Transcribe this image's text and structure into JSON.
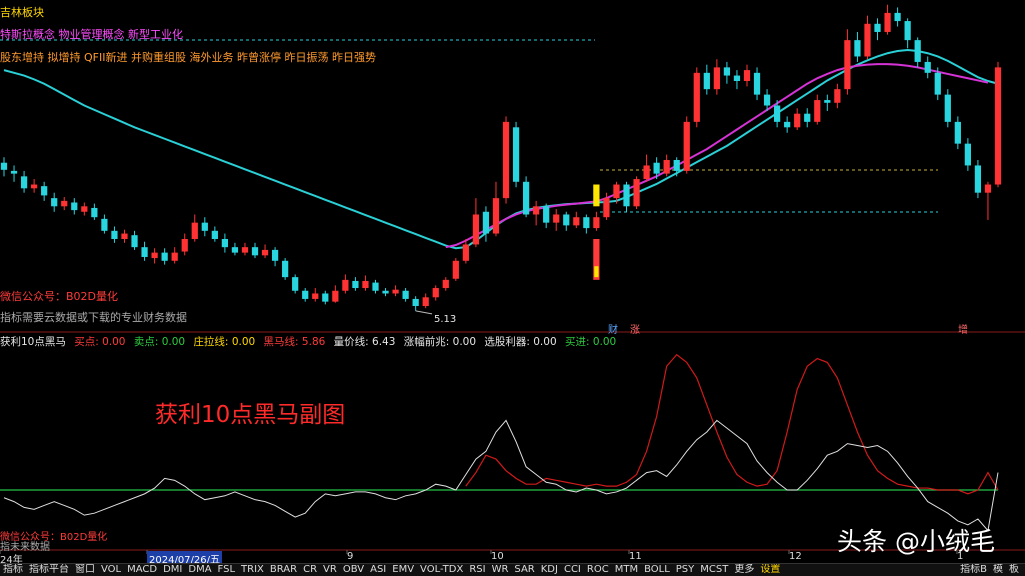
{
  "main_panel": {
    "sector_label": "吉林板块",
    "concept_line": "特斯拉概念 物业管理概念 新型工业化",
    "tags_line": "股东增持 拟增持 QFII新进 并购重组股 海外业务 昨曾涨停 昨日振荡 昨日强势",
    "wechat_note": "微信公众号：B02D量化",
    "data_note": "指标需要云数据或下载的专业财务数据",
    "low_price_label": "5.13",
    "event_markers": [
      "财",
      "涨",
      "增"
    ]
  },
  "indicator_header": {
    "title": "获利10点黑马",
    "items": [
      {
        "label": "买点: 0.00",
        "color": "#ff3b3b"
      },
      {
        "label": "卖点: 0.00",
        "color": "#2ecc40"
      },
      {
        "label": "庄拉线: 0.00",
        "color": "#ffd800"
      },
      {
        "label": "黑马线: 5.86",
        "color": "#ff3b3b"
      },
      {
        "label": "量价线: 6.43",
        "color": "#e6e6e6"
      },
      {
        "label": "涨幅前兆: 0.00",
        "color": "#e6e6e6"
      },
      {
        "label": "选股利器: 0.00",
        "color": "#e6e6e6"
      },
      {
        "label": "买进: 0.00",
        "color": "#2ecc40"
      }
    ]
  },
  "subchart_title": "获利10点黑马副图",
  "sub_notes": {
    "wechat_note": "微信公众号：B02D量化",
    "future_note": "指未来数据"
  },
  "watermark": "头条 @小绒毛",
  "date_axis": {
    "labels": [
      "24年",
      "2024/07/26/五",
      "9",
      "10",
      "11",
      "12",
      "1"
    ]
  },
  "tabbar": {
    "items": [
      "指标",
      "指标平台",
      "窗口",
      "VOL",
      "MACD",
      "DMI",
      "DMA",
      "FSL",
      "TRIX",
      "BRAR",
      "CR",
      "VR",
      "OBV",
      "ASI",
      "EMV",
      "VOL-TDX",
      "RSI",
      "WR",
      "SAR",
      "KDJ",
      "CCI",
      "ROC",
      "MTM",
      "BOLL",
      "PSY",
      "MCST",
      "更多",
      "设置"
    ],
    "right_items": [
      "指标B",
      "模",
      "板"
    ]
  },
  "colors": {
    "up": "#ff3333",
    "down": "#29d6e0",
    "ma_long": "#2ad0d6",
    "ma_short": "#d633d6",
    "sub_red": "#d11a1a",
    "sub_white": "#e0e0e0",
    "sub_green": "#22c44a"
  },
  "chart_data": [
    {
      "type": "candlestick",
      "title": "",
      "low_annotation": 5.13,
      "series": [
        {
          "name": "",
          "type": "ma_long",
          "values": [
            9.55,
            9.5,
            9.45,
            9.38,
            9.3,
            9.2,
            9.1,
            9.0,
            8.9,
            8.82,
            8.74,
            8.66,
            8.58,
            8.5,
            8.43,
            8.36,
            8.29,
            8.22,
            8.15,
            8.08,
            8.01,
            7.94,
            7.87,
            7.8,
            7.73,
            7.66,
            7.59,
            7.52,
            7.45,
            7.38,
            7.31,
            7.24,
            7.17,
            7.1,
            7.03,
            6.96,
            6.89,
            6.82,
            6.75,
            6.68,
            6.61,
            6.54,
            6.47,
            6.4,
            6.33,
            6.28,
            6.3,
            6.42,
            6.56,
            6.7,
            6.82,
            6.92,
            6.98,
            7.02,
            7.05,
            7.07,
            7.09,
            7.1,
            7.11,
            7.12,
            7.13,
            7.15,
            7.22,
            7.3,
            7.38,
            7.46,
            7.56,
            7.66,
            7.76,
            7.86,
            7.96,
            8.06,
            8.16,
            8.28,
            8.4,
            8.52,
            8.64,
            8.76,
            8.88,
            9.0,
            9.12,
            9.24,
            9.36,
            9.46,
            9.56,
            9.65,
            9.73,
            9.8,
            9.86,
            9.9,
            9.92,
            9.9,
            9.86,
            9.8,
            9.72,
            9.62,
            9.52,
            9.42,
            9.35,
            9.3
          ]
        },
        {
          "name": "",
          "type": "ma_short",
          "start_index": 44,
          "values": [
            6.3,
            6.34,
            6.42,
            6.52,
            6.62,
            6.72,
            6.82,
            6.9,
            6.96,
            7.0,
            7.03,
            7.06,
            7.08,
            7.1,
            7.12,
            7.14,
            7.2,
            7.28,
            7.36,
            7.44,
            7.52,
            7.6,
            7.7,
            7.8,
            7.9,
            8.0,
            8.1,
            8.22,
            8.34,
            8.46,
            8.58,
            8.7,
            8.82,
            8.94,
            9.06,
            9.18,
            9.3,
            9.4,
            9.48,
            9.55,
            9.6,
            9.63,
            9.65,
            9.66,
            9.66,
            9.65,
            9.63,
            9.6,
            9.56,
            9.52,
            9.48,
            9.44,
            9.4,
            9.36,
            9.32
          ]
        }
      ],
      "candles": [
        [
          7.85,
          7.72,
          7.95,
          7.6
        ],
        [
          7.7,
          7.65,
          7.8,
          7.5
        ],
        [
          7.6,
          7.38,
          7.7,
          7.3
        ],
        [
          7.38,
          7.45,
          7.55,
          7.3
        ],
        [
          7.42,
          7.25,
          7.5,
          7.15
        ],
        [
          7.2,
          7.05,
          7.3,
          6.95
        ],
        [
          7.05,
          7.15,
          7.22,
          6.98
        ],
        [
          7.12,
          6.98,
          7.2,
          6.9
        ],
        [
          6.95,
          7.05,
          7.12,
          6.88
        ],
        [
          7.02,
          6.85,
          7.1,
          6.8
        ],
        [
          6.82,
          6.6,
          6.9,
          6.55
        ],
        [
          6.6,
          6.45,
          6.68,
          6.38
        ],
        [
          6.45,
          6.55,
          6.62,
          6.38
        ],
        [
          6.52,
          6.3,
          6.6,
          6.25
        ],
        [
          6.3,
          6.12,
          6.4,
          6.05
        ],
        [
          6.1,
          6.2,
          6.28,
          6.0
        ],
        [
          6.2,
          6.05,
          6.28,
          5.98
        ],
        [
          6.05,
          6.2,
          6.3,
          6.0
        ],
        [
          6.22,
          6.45,
          6.55,
          6.15
        ],
        [
          6.45,
          6.75,
          6.9,
          6.4
        ],
        [
          6.75,
          6.6,
          6.85,
          6.5
        ],
        [
          6.6,
          6.45,
          6.68,
          6.4
        ],
        [
          6.45,
          6.3,
          6.55,
          6.2
        ],
        [
          6.3,
          6.2,
          6.38,
          6.15
        ],
        [
          6.2,
          6.3,
          6.38,
          6.15
        ],
        [
          6.3,
          6.15,
          6.38,
          6.1
        ],
        [
          6.15,
          6.25,
          6.35,
          6.1
        ],
        [
          6.25,
          6.05,
          6.3,
          5.95
        ],
        [
          6.05,
          5.75,
          6.1,
          5.7
        ],
        [
          5.75,
          5.5,
          5.8,
          5.45
        ],
        [
          5.5,
          5.35,
          5.55,
          5.3
        ],
        [
          5.35,
          5.45,
          5.55,
          5.3
        ],
        [
          5.45,
          5.3,
          5.5,
          5.25
        ],
        [
          5.3,
          5.5,
          5.6,
          5.28
        ],
        [
          5.5,
          5.7,
          5.8,
          5.45
        ],
        [
          5.68,
          5.55,
          5.75,
          5.5
        ],
        [
          5.55,
          5.68,
          5.78,
          5.5
        ],
        [
          5.65,
          5.5,
          5.7,
          5.45
        ],
        [
          5.5,
          5.45,
          5.55,
          5.4
        ],
        [
          5.45,
          5.52,
          5.6,
          5.4
        ],
        [
          5.5,
          5.35,
          5.55,
          5.3
        ],
        [
          5.35,
          5.22,
          5.4,
          5.13
        ],
        [
          5.22,
          5.38,
          5.45,
          5.18
        ],
        [
          5.38,
          5.55,
          5.6,
          5.32
        ],
        [
          5.55,
          5.7,
          5.75,
          5.5
        ],
        [
          5.72,
          6.05,
          6.1,
          5.68
        ],
        [
          6.05,
          6.35,
          6.45,
          6.0
        ],
        [
          6.35,
          6.9,
          7.2,
          6.3
        ],
        [
          6.95,
          6.55,
          7.05,
          6.4
        ],
        [
          6.55,
          7.2,
          7.5,
          6.5
        ],
        [
          7.2,
          8.6,
          8.7,
          7.1
        ],
        [
          8.5,
          7.5,
          8.6,
          7.4
        ],
        [
          7.5,
          6.9,
          7.6,
          6.85
        ],
        [
          6.9,
          7.05,
          7.15,
          6.7
        ],
        [
          7.05,
          6.75,
          7.1,
          6.65
        ],
        [
          6.75,
          6.9,
          7.0,
          6.6
        ],
        [
          6.9,
          6.7,
          6.95,
          6.6
        ],
        [
          6.7,
          6.85,
          6.95,
          6.65
        ],
        [
          6.85,
          6.65,
          6.9,
          6.55
        ],
        [
          6.65,
          6.85,
          6.95,
          6.6
        ],
        [
          6.85,
          7.2,
          7.3,
          6.8
        ],
        [
          7.2,
          7.45,
          7.5,
          7.1
        ],
        [
          7.45,
          7.05,
          7.5,
          6.95
        ],
        [
          7.05,
          7.55,
          7.6,
          7.0
        ],
        [
          7.55,
          7.8,
          8.0,
          7.5
        ],
        [
          7.85,
          7.65,
          7.95,
          7.55
        ],
        [
          7.65,
          7.9,
          8.0,
          7.6
        ],
        [
          7.9,
          7.7,
          7.95,
          7.6
        ],
        [
          7.7,
          8.6,
          8.7,
          7.65
        ],
        [
          8.6,
          9.5,
          9.6,
          8.5
        ],
        [
          9.5,
          9.2,
          9.65,
          9.1
        ],
        [
          9.2,
          9.6,
          9.75,
          9.1
        ],
        [
          9.6,
          9.45,
          9.7,
          9.3
        ],
        [
          9.45,
          9.35,
          9.55,
          9.2
        ],
        [
          9.35,
          9.55,
          9.65,
          9.25
        ],
        [
          9.5,
          9.1,
          9.6,
          9.0
        ],
        [
          9.1,
          8.9,
          9.2,
          8.8
        ],
        [
          8.9,
          8.6,
          9.0,
          8.5
        ],
        [
          8.6,
          8.5,
          8.7,
          8.4
        ],
        [
          8.5,
          8.75,
          8.85,
          8.45
        ],
        [
          8.75,
          8.6,
          8.85,
          8.5
        ],
        [
          8.6,
          9.0,
          9.1,
          8.55
        ],
        [
          9.0,
          8.95,
          9.1,
          8.8
        ],
        [
          8.95,
          9.2,
          9.3,
          8.85
        ],
        [
          9.2,
          10.1,
          10.3,
          9.1
        ],
        [
          10.1,
          9.8,
          10.25,
          9.7
        ],
        [
          9.8,
          10.4,
          10.55,
          9.75
        ],
        [
          10.4,
          10.25,
          10.5,
          10.1
        ],
        [
          10.25,
          10.6,
          10.75,
          10.2
        ],
        [
          10.6,
          10.45,
          10.7,
          10.35
        ],
        [
          10.45,
          10.1,
          10.5,
          9.95
        ],
        [
          10.1,
          9.7,
          10.15,
          9.6
        ],
        [
          9.7,
          9.5,
          9.8,
          9.4
        ],
        [
          9.5,
          9.1,
          9.6,
          9.0
        ],
        [
          9.1,
          8.6,
          9.2,
          8.5
        ],
        [
          8.6,
          8.2,
          8.7,
          8.1
        ],
        [
          8.2,
          7.8,
          8.3,
          7.7
        ],
        [
          7.8,
          7.3,
          7.9,
          7.2
        ],
        [
          7.3,
          7.45,
          7.5,
          6.8
        ],
        [
          7.45,
          9.6,
          9.7,
          7.4
        ]
      ],
      "ohlc_order": [
        "open",
        "close",
        "high",
        "low"
      ],
      "ylim": [
        5.0,
        10.8
      ]
    },
    {
      "type": "line",
      "title": "获利10点黑马副图",
      "series": [
        {
          "name": "量价线",
          "color": "#e0e0e0",
          "values": [
            -0.4,
            -0.6,
            -0.9,
            -1.0,
            -0.8,
            -0.6,
            -0.8,
            -1.0,
            -1.3,
            -1.2,
            -1.0,
            -0.8,
            -0.6,
            -0.4,
            -0.2,
            0.1,
            0.6,
            0.5,
            0.2,
            -0.2,
            -0.5,
            -0.4,
            -0.3,
            -0.1,
            -0.3,
            -0.5,
            -0.6,
            -0.8,
            -1.1,
            -1.4,
            -1.2,
            -0.6,
            -0.2,
            -0.3,
            -0.2,
            -0.1,
            -0.1,
            -0.2,
            -0.4,
            -0.5,
            -0.3,
            -0.2,
            0.0,
            0.3,
            0.2,
            0.0,
            0.8,
            1.6,
            2.0,
            3.0,
            3.6,
            2.5,
            1.2,
            0.8,
            0.4,
            0.3,
            0.0,
            -0.1,
            0.1,
            0.0,
            -0.2,
            -0.1,
            0.1,
            0.5,
            0.9,
            1.0,
            0.7,
            1.3,
            2.0,
            2.6,
            3.0,
            3.6,
            3.2,
            2.8,
            2.4,
            1.5,
            0.9,
            0.4,
            0.0,
            0.0,
            0.5,
            1.1,
            1.8,
            2.0,
            2.4,
            2.3,
            2.2,
            2.3,
            2.0,
            1.4,
            0.7,
            0.1,
            -0.6,
            -0.9,
            -1.2,
            -1.6,
            -1.8,
            -1.5,
            -2.1,
            0.9
          ]
        },
        {
          "name": "黑马线",
          "color": "#d11a1a",
          "start_index": 46,
          "values": [
            0.2,
            0.9,
            1.8,
            1.6,
            1.0,
            0.6,
            0.3,
            0.3,
            0.6,
            0.5,
            0.4,
            0.3,
            0.2,
            0.3,
            0.2,
            0.2,
            0.4,
            0.8,
            2.0,
            3.8,
            6.4,
            7.0,
            6.6,
            5.8,
            4.4,
            3.0,
            1.7,
            0.8,
            0.4,
            0.2,
            0.3,
            1.0,
            3.0,
            5.2,
            6.4,
            6.8,
            6.6,
            5.8,
            4.4,
            3.0,
            1.8,
            1.0,
            0.6,
            0.3,
            0.2,
            0.1,
            0.1,
            0.0,
            0.0,
            0.0,
            -0.2,
            0.0,
            0.9,
            0.0
          ]
        },
        {
          "name": "零轴",
          "color": "#22c44a",
          "values": [
            0
          ]
        }
      ],
      "ylim": [
        -3.0,
        7.5
      ]
    }
  ]
}
